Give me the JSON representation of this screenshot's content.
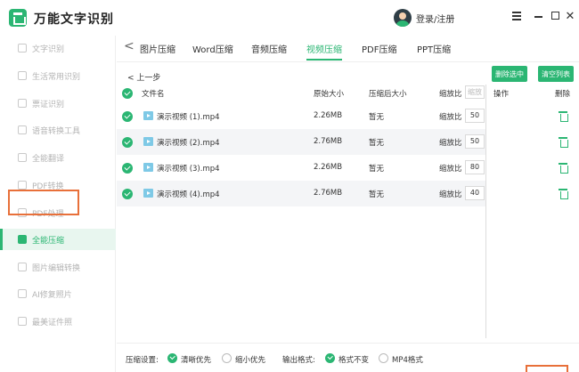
{
  "app": {
    "title": "万能文字识别"
  },
  "user": {
    "login_label": "登录/注册"
  },
  "sidebar": {
    "items": [
      {
        "label": "文字识别"
      },
      {
        "label": "生活常用识别"
      },
      {
        "label": "票证识别"
      },
      {
        "label": "语音转换工具"
      },
      {
        "label": "全能翻译"
      },
      {
        "label": "PDF转换"
      },
      {
        "label": "PDF处理"
      },
      {
        "label": "全能压缩"
      },
      {
        "label": "图片编辑转换"
      },
      {
        "label": "AI修复照片"
      },
      {
        "label": "最美证件照"
      }
    ],
    "active_index": 7
  },
  "tabs": {
    "back_glyph": "<",
    "items": [
      {
        "label": "图片压缩"
      },
      {
        "label": "Word压缩"
      },
      {
        "label": "音频压缩"
      },
      {
        "label": "视频压缩"
      },
      {
        "label": "PDF压缩"
      },
      {
        "label": "PPT压缩"
      }
    ],
    "active_index": 3
  },
  "toolbar": {
    "back_label": "< 上一步",
    "delete_selected_label": "删除选中",
    "clear_list_label": "清空列表"
  },
  "table": {
    "headers": {
      "filename": "文件名",
      "original_size": "原始大小",
      "compressed_size": "压缩后大小",
      "ratio": "缩放比",
      "ratio_placeholder": "缩放",
      "action": "操作",
      "delete": "删除"
    },
    "rows": [
      {
        "name": "演示视频 (1).mp4",
        "original": "2.26MB",
        "compressed": "暂无",
        "ratio_label": "缩放比",
        "ratio": "50"
      },
      {
        "name": "演示视频 (2).mp4",
        "original": "2.76MB",
        "compressed": "暂无",
        "ratio_label": "缩放比",
        "ratio": "50"
      },
      {
        "name": "演示视频 (3).mp4",
        "original": "2.26MB",
        "compressed": "暂无",
        "ratio_label": "缩放比",
        "ratio": "80"
      },
      {
        "name": "演示视频 (4).mp4",
        "original": "2.76MB",
        "compressed": "暂无",
        "ratio_label": "缩放比",
        "ratio": "40"
      }
    ]
  },
  "footer": {
    "compress_label": "压缩设置:",
    "opt_clear": "清晰优先",
    "opt_small": "缩小优先",
    "format_label": "输出格式:",
    "opt_keep": "格式不变",
    "opt_mp4": "MP4格式"
  },
  "colors": {
    "accent": "#2bb673",
    "highlight": "#e8703a"
  }
}
